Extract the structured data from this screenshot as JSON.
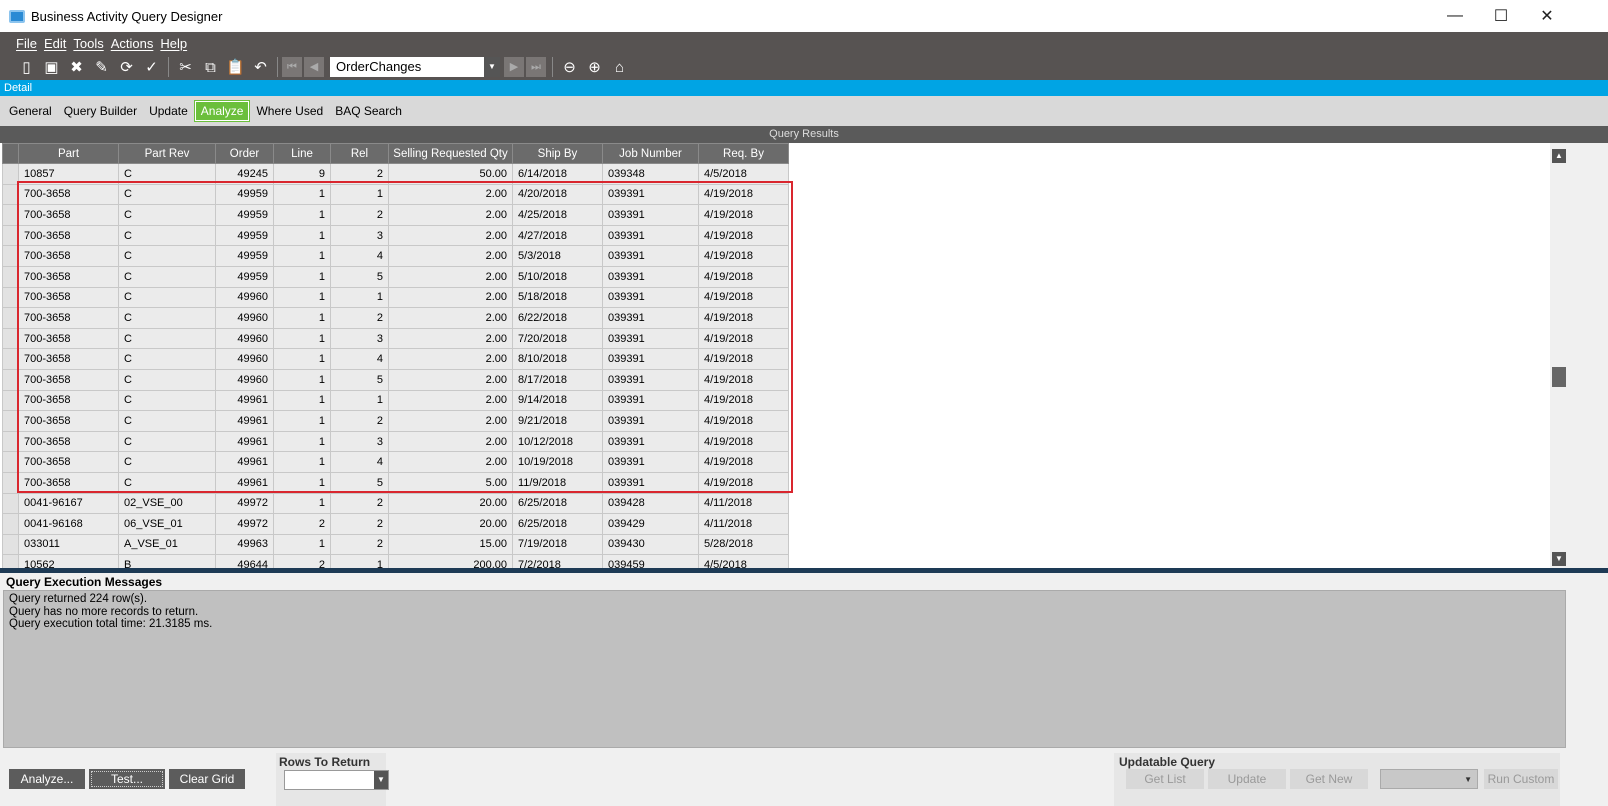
{
  "window": {
    "title": "Business Activity Query Designer",
    "minimize": "—",
    "maximize": "☐",
    "close": "✕"
  },
  "menu": [
    "File",
    "Edit",
    "Tools",
    "Actions",
    "Help"
  ],
  "toolbar": {
    "query_id": "OrderChanges"
  },
  "detail_label": "Detail",
  "tabs": [
    {
      "label": "General"
    },
    {
      "label": "Query Builder"
    },
    {
      "label": "Update"
    },
    {
      "label": "Analyze",
      "active": true
    },
    {
      "label": "Where Used"
    },
    {
      "label": "BAQ Search"
    }
  ],
  "results": {
    "title": "Query Results",
    "columns": [
      "Part",
      "Part Rev",
      "Order",
      "Line",
      "Rel",
      "Selling Requested Qty",
      "Ship By",
      "Job Number",
      "Req. By"
    ],
    "rows": [
      [
        "10857",
        "C",
        "49245",
        "9",
        "2",
        "50.00",
        "6/14/2018",
        "039348",
        "4/5/2018"
      ],
      [
        "700-3658",
        "C",
        "49959",
        "1",
        "1",
        "2.00",
        "4/20/2018",
        "039391",
        "4/19/2018"
      ],
      [
        "700-3658",
        "C",
        "49959",
        "1",
        "2",
        "2.00",
        "4/25/2018",
        "039391",
        "4/19/2018"
      ],
      [
        "700-3658",
        "C",
        "49959",
        "1",
        "3",
        "2.00",
        "4/27/2018",
        "039391",
        "4/19/2018"
      ],
      [
        "700-3658",
        "C",
        "49959",
        "1",
        "4",
        "2.00",
        "5/3/2018",
        "039391",
        "4/19/2018"
      ],
      [
        "700-3658",
        "C",
        "49959",
        "1",
        "5",
        "2.00",
        "5/10/2018",
        "039391",
        "4/19/2018"
      ],
      [
        "700-3658",
        "C",
        "49960",
        "1",
        "1",
        "2.00",
        "5/18/2018",
        "039391",
        "4/19/2018"
      ],
      [
        "700-3658",
        "C",
        "49960",
        "1",
        "2",
        "2.00",
        "6/22/2018",
        "039391",
        "4/19/2018"
      ],
      [
        "700-3658",
        "C",
        "49960",
        "1",
        "3",
        "2.00",
        "7/20/2018",
        "039391",
        "4/19/2018"
      ],
      [
        "700-3658",
        "C",
        "49960",
        "1",
        "4",
        "2.00",
        "8/10/2018",
        "039391",
        "4/19/2018"
      ],
      [
        "700-3658",
        "C",
        "49960",
        "1",
        "5",
        "2.00",
        "8/17/2018",
        "039391",
        "4/19/2018"
      ],
      [
        "700-3658",
        "C",
        "49961",
        "1",
        "1",
        "2.00",
        "9/14/2018",
        "039391",
        "4/19/2018"
      ],
      [
        "700-3658",
        "C",
        "49961",
        "1",
        "2",
        "2.00",
        "9/21/2018",
        "039391",
        "4/19/2018"
      ],
      [
        "700-3658",
        "C",
        "49961",
        "1",
        "3",
        "2.00",
        "10/12/2018",
        "039391",
        "4/19/2018"
      ],
      [
        "700-3658",
        "C",
        "49961",
        "1",
        "4",
        "2.00",
        "10/19/2018",
        "039391",
        "4/19/2018"
      ],
      [
        "700-3658",
        "C",
        "49961",
        "1",
        "5",
        "5.00",
        "11/9/2018",
        "039391",
        "4/19/2018"
      ],
      [
        "0041-96167",
        "02_VSE_00",
        "49972",
        "1",
        "2",
        "20.00",
        "6/25/2018",
        "039428",
        "4/11/2018"
      ],
      [
        "0041-96168",
        "06_VSE_01",
        "49972",
        "2",
        "2",
        "20.00",
        "6/25/2018",
        "039429",
        "4/11/2018"
      ],
      [
        "033011",
        "A_VSE_01",
        "49963",
        "1",
        "2",
        "15.00",
        "7/19/2018",
        "039430",
        "5/28/2018"
      ],
      [
        "10562",
        "B",
        "49644",
        "2",
        "1",
        "200.00",
        "7/2/2018",
        "039459",
        "4/5/2018"
      ]
    ]
  },
  "messages": {
    "title": "Query Execution Messages",
    "lines": [
      "Query returned 224 row(s).",
      "Query has no more records to return.",
      "Query execution total time: 21.3185 ms."
    ]
  },
  "buttons": {
    "analyze": "Analyze...",
    "test": "Test...",
    "clear": "Clear Grid"
  },
  "rows_to_return": {
    "label": "Rows To Return",
    "value": ""
  },
  "updatable": {
    "label": "Updatable Query",
    "get_list": "Get List",
    "update": "Update",
    "get_new": "Get New",
    "custom_value": "",
    "run_custom": "Run Custom"
  }
}
